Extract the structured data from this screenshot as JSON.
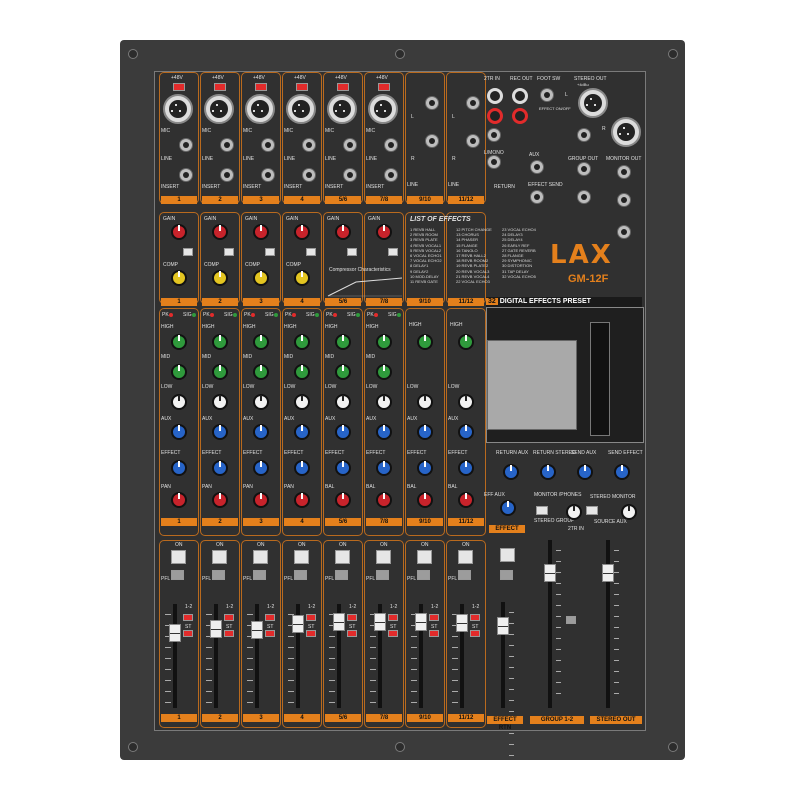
{
  "brand": {
    "logo": "LAX",
    "model": "GM-12F",
    "preset_banner": "DIGITAL EFFECTS PRESET",
    "preset_count": "32"
  },
  "channels": [
    {
      "id": "1",
      "mono": true,
      "phantom": "+48V"
    },
    {
      "id": "2",
      "mono": true,
      "phantom": "+48V"
    },
    {
      "id": "3",
      "mono": true,
      "phantom": "+48V"
    },
    {
      "id": "4",
      "mono": true,
      "phantom": "+48V"
    },
    {
      "id": "5/6",
      "mono": true,
      "phantom": "+48V"
    },
    {
      "id": "7/8",
      "mono": true,
      "phantom": "+48V"
    },
    {
      "id": "9/10",
      "mono": false
    },
    {
      "id": "11/12",
      "mono": false
    }
  ],
  "input_labels": {
    "mic": "MIC",
    "line": "LINE",
    "insert": "INSERT",
    "gain": "GAIN",
    "comp": "COMP",
    "pk": "PK",
    "sig": "SIG",
    "high": "HIGH",
    "mid": "MID",
    "low": "LOW",
    "aux": "AUX",
    "effect": "EFFECT",
    "pan": "PAN",
    "bal": "BAL",
    "on": "ON",
    "pfl": "PFL",
    "st": "ST",
    "assign": "1-2",
    "l_mono": "L/MONO",
    "l": "L",
    "r": "R"
  },
  "io": {
    "two_tr_in": "2TR IN",
    "rec_out": "REC OUT",
    "foot_sw": "FOOT SW",
    "effect_onoff": "EFFECT ON/OFF",
    "stereo_out": "STEREO OUT",
    "stereo_out_level": "+4dBu",
    "group_out": "GROUP OUT",
    "monitor_out": "MONITOR OUT",
    "aux": "AUX",
    "return": "RETURN",
    "effect_send": "EFFECT SEND",
    "phones": "PHONES"
  },
  "compressor": {
    "title": "Compressor Characteristics"
  },
  "effects_list": {
    "title": "LIST OF EFFECTS",
    "items": [
      "1 REVB HALL",
      "2 REVB ROOM",
      "3 REVB PLATE",
      "4 REVB VOCAL1",
      "5 REVB VOCAL2",
      "6 VOCAL ECHO1",
      "7 VOCAL ECHO2",
      "8 DELAY1",
      "9 DELAY2",
      "10 MOD.DELAY",
      "11 REVB GATE",
      "12 PITCH CHANGE",
      "13 CHORUS",
      "14 PHASER",
      "15 FLANGE",
      "16 TANOLO",
      "17 REVB HALL2",
      "18 REVB ROOM2",
      "19 REVB PLATE2",
      "20 REVB VOCAL3",
      "21 REVB VOCAL4",
      "22 VOCAL ECHO3",
      "23 VOCAL ECHO4",
      "24 DELAY3",
      "25 DELAY4",
      "26 EARLY REF",
      "27 GATE REVERB",
      "28 FLANGE",
      "29 SYMPHONIC",
      "30 DISTORTION",
      "31 TAP DELAY",
      "32 VOCAL ECHO5"
    ]
  },
  "master": {
    "return_aux": "RETURN AUX",
    "return_stereo": "RETURN STEREO",
    "send_aux": "SEND AUX",
    "send_effect": "SEND EFFECT",
    "eff_aux": "EFF AUX",
    "effect_button": "EFFECT",
    "monitor_phones": "MONITOR /PHONES",
    "stereo_group": "STEREO GROUP",
    "stereo_monitor": "STEREO MONITOR",
    "two_tr_in": "2TR IN",
    "source_aux": "SOURCE AUX",
    "fader_labels": [
      "EFFECT RTN",
      "GROUP 1-2",
      "STEREO OUT"
    ]
  },
  "fader_levels": [
    0.28,
    0.24,
    0.25,
    0.19,
    0.17,
    0.17,
    0.17,
    0.18,
    0.14,
    0.86,
    0.86
  ]
}
